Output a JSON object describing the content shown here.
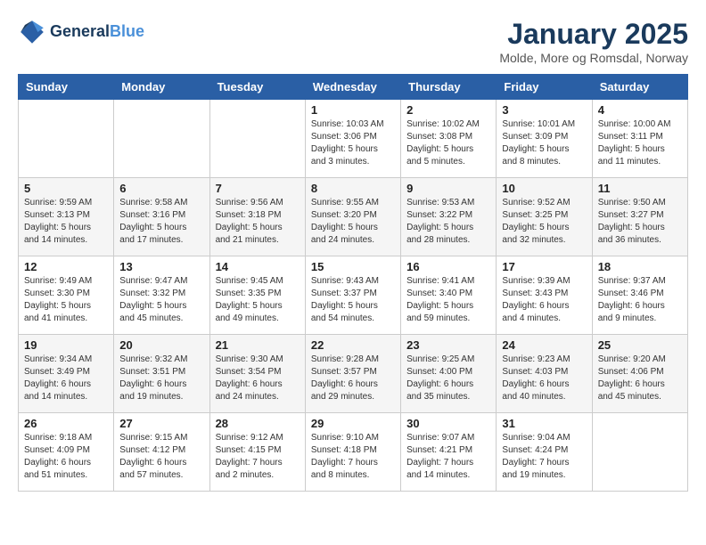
{
  "header": {
    "logo_line1": "General",
    "logo_line2": "Blue",
    "month": "January 2025",
    "location": "Molde, More og Romsdal, Norway"
  },
  "weekdays": [
    "Sunday",
    "Monday",
    "Tuesday",
    "Wednesday",
    "Thursday",
    "Friday",
    "Saturday"
  ],
  "weeks": [
    [
      {
        "day": "",
        "info": ""
      },
      {
        "day": "",
        "info": ""
      },
      {
        "day": "",
        "info": ""
      },
      {
        "day": "1",
        "info": "Sunrise: 10:03 AM\nSunset: 3:06 PM\nDaylight: 5 hours\nand 3 minutes."
      },
      {
        "day": "2",
        "info": "Sunrise: 10:02 AM\nSunset: 3:08 PM\nDaylight: 5 hours\nand 5 minutes."
      },
      {
        "day": "3",
        "info": "Sunrise: 10:01 AM\nSunset: 3:09 PM\nDaylight: 5 hours\nand 8 minutes."
      },
      {
        "day": "4",
        "info": "Sunrise: 10:00 AM\nSunset: 3:11 PM\nDaylight: 5 hours\nand 11 minutes."
      }
    ],
    [
      {
        "day": "5",
        "info": "Sunrise: 9:59 AM\nSunset: 3:13 PM\nDaylight: 5 hours\nand 14 minutes."
      },
      {
        "day": "6",
        "info": "Sunrise: 9:58 AM\nSunset: 3:16 PM\nDaylight: 5 hours\nand 17 minutes."
      },
      {
        "day": "7",
        "info": "Sunrise: 9:56 AM\nSunset: 3:18 PM\nDaylight: 5 hours\nand 21 minutes."
      },
      {
        "day": "8",
        "info": "Sunrise: 9:55 AM\nSunset: 3:20 PM\nDaylight: 5 hours\nand 24 minutes."
      },
      {
        "day": "9",
        "info": "Sunrise: 9:53 AM\nSunset: 3:22 PM\nDaylight: 5 hours\nand 28 minutes."
      },
      {
        "day": "10",
        "info": "Sunrise: 9:52 AM\nSunset: 3:25 PM\nDaylight: 5 hours\nand 32 minutes."
      },
      {
        "day": "11",
        "info": "Sunrise: 9:50 AM\nSunset: 3:27 PM\nDaylight: 5 hours\nand 36 minutes."
      }
    ],
    [
      {
        "day": "12",
        "info": "Sunrise: 9:49 AM\nSunset: 3:30 PM\nDaylight: 5 hours\nand 41 minutes."
      },
      {
        "day": "13",
        "info": "Sunrise: 9:47 AM\nSunset: 3:32 PM\nDaylight: 5 hours\nand 45 minutes."
      },
      {
        "day": "14",
        "info": "Sunrise: 9:45 AM\nSunset: 3:35 PM\nDaylight: 5 hours\nand 49 minutes."
      },
      {
        "day": "15",
        "info": "Sunrise: 9:43 AM\nSunset: 3:37 PM\nDaylight: 5 hours\nand 54 minutes."
      },
      {
        "day": "16",
        "info": "Sunrise: 9:41 AM\nSunset: 3:40 PM\nDaylight: 5 hours\nand 59 minutes."
      },
      {
        "day": "17",
        "info": "Sunrise: 9:39 AM\nSunset: 3:43 PM\nDaylight: 6 hours\nand 4 minutes."
      },
      {
        "day": "18",
        "info": "Sunrise: 9:37 AM\nSunset: 3:46 PM\nDaylight: 6 hours\nand 9 minutes."
      }
    ],
    [
      {
        "day": "19",
        "info": "Sunrise: 9:34 AM\nSunset: 3:49 PM\nDaylight: 6 hours\nand 14 minutes."
      },
      {
        "day": "20",
        "info": "Sunrise: 9:32 AM\nSunset: 3:51 PM\nDaylight: 6 hours\nand 19 minutes."
      },
      {
        "day": "21",
        "info": "Sunrise: 9:30 AM\nSunset: 3:54 PM\nDaylight: 6 hours\nand 24 minutes."
      },
      {
        "day": "22",
        "info": "Sunrise: 9:28 AM\nSunset: 3:57 PM\nDaylight: 6 hours\nand 29 minutes."
      },
      {
        "day": "23",
        "info": "Sunrise: 9:25 AM\nSunset: 4:00 PM\nDaylight: 6 hours\nand 35 minutes."
      },
      {
        "day": "24",
        "info": "Sunrise: 9:23 AM\nSunset: 4:03 PM\nDaylight: 6 hours\nand 40 minutes."
      },
      {
        "day": "25",
        "info": "Sunrise: 9:20 AM\nSunset: 4:06 PM\nDaylight: 6 hours\nand 45 minutes."
      }
    ],
    [
      {
        "day": "26",
        "info": "Sunrise: 9:18 AM\nSunset: 4:09 PM\nDaylight: 6 hours\nand 51 minutes."
      },
      {
        "day": "27",
        "info": "Sunrise: 9:15 AM\nSunset: 4:12 PM\nDaylight: 6 hours\nand 57 minutes."
      },
      {
        "day": "28",
        "info": "Sunrise: 9:12 AM\nSunset: 4:15 PM\nDaylight: 7 hours\nand 2 minutes."
      },
      {
        "day": "29",
        "info": "Sunrise: 9:10 AM\nSunset: 4:18 PM\nDaylight: 7 hours\nand 8 minutes."
      },
      {
        "day": "30",
        "info": "Sunrise: 9:07 AM\nSunset: 4:21 PM\nDaylight: 7 hours\nand 14 minutes."
      },
      {
        "day": "31",
        "info": "Sunrise: 9:04 AM\nSunset: 4:24 PM\nDaylight: 7 hours\nand 19 minutes."
      },
      {
        "day": "",
        "info": ""
      }
    ]
  ]
}
